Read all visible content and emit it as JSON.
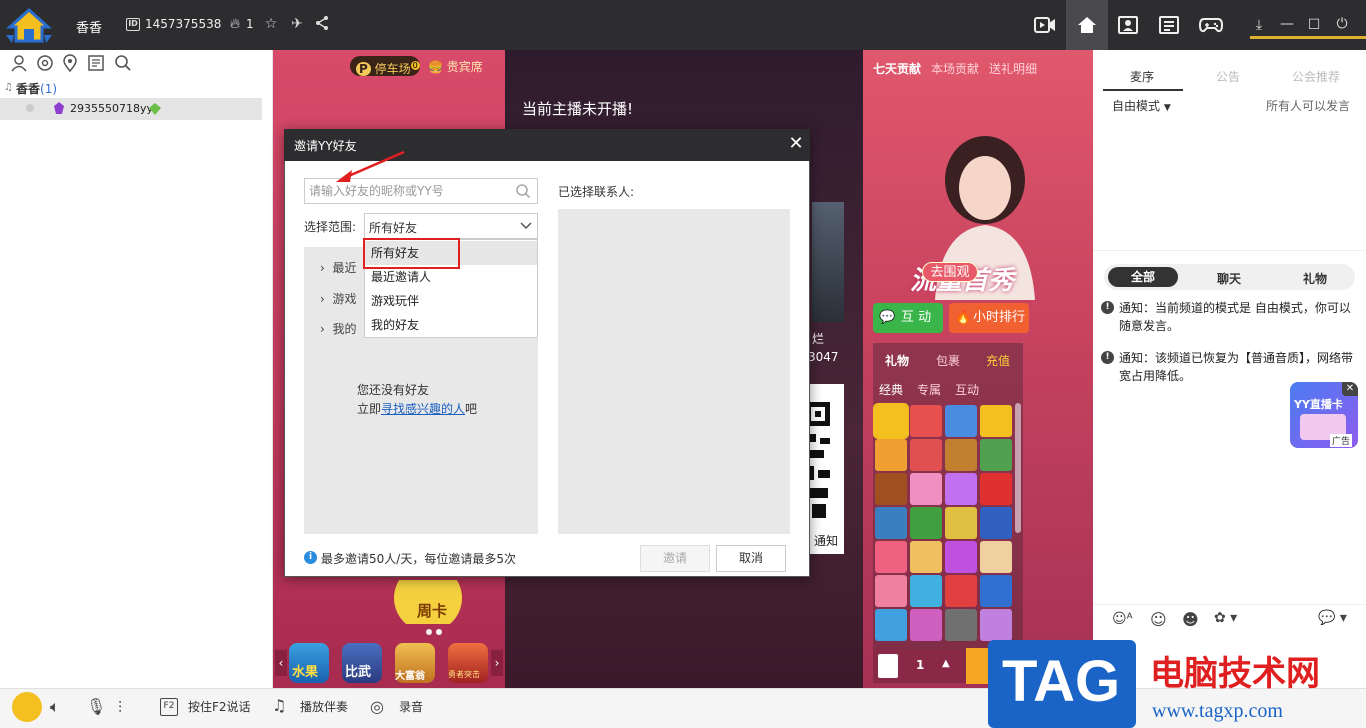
{
  "topbar": {
    "room_name": "香香",
    "room_id": "1457375538",
    "id_badge": "ID",
    "fire_count": "1"
  },
  "left": {
    "tree_root_name": "香香",
    "tree_root_count": "(1)",
    "tree_user": "2935550718yy"
  },
  "stage": {
    "parking": "停车场",
    "parking_count": "0",
    "vip_seat": "贵宾席",
    "not_live": "当前主播未开播!",
    "tabs": [
      "七天贡献",
      "本场贡献",
      "送礼明细"
    ],
    "go_watch": "去围观",
    "host_title": "流量首秀",
    "interact": "互 动",
    "rank": "小时排行",
    "gift_tabs": [
      "礼物",
      "包裹",
      "充值"
    ],
    "gift_sub": [
      "经典",
      "专属",
      "互动"
    ],
    "gift_qty": "1",
    "peek_text1": "烂",
    "peek_text2": "3047",
    "peek_text3": "通知",
    "week_card": "周卡",
    "bottom_games": [
      "水果",
      "比武",
      "大富翁",
      "勇者突击"
    ]
  },
  "right": {
    "tabs": [
      "麦序",
      "公告",
      "公会推荐"
    ],
    "free_mode": "自由模式",
    "all_speak": "所有人可以发言",
    "chat_tabs": [
      "全部",
      "聊天",
      "礼物"
    ],
    "notice1": "通知：当前频道的模式是 自由模式，你可以随意发言。",
    "notice2": "通知：该频道已恢复为【普通音质】，网络带宽占用降低。",
    "ad_title": "YY直播卡",
    "ad_label": "广告"
  },
  "bottom": {
    "f2_key": "F2",
    "f2_label": "按住F2说话",
    "music": "播放伴奏",
    "record": "录音"
  },
  "dialog": {
    "title": "邀请YY好友",
    "close": "✕",
    "search_placeholder": "请输入好友的昵称或YY号",
    "scope_label": "选择范围:",
    "scope_value": "所有好友",
    "dropdown_options": [
      "所有好友",
      "最近邀请人",
      "游戏玩伴",
      "我的好友"
    ],
    "groups_partial": [
      "最近",
      "游戏",
      "我的"
    ],
    "empty_line1": "您还没有好友",
    "empty_line2_prefix": "立即",
    "empty_line2_link": "寻找感兴趣的人",
    "empty_line2_suffix": "吧",
    "selected_label": "已选择联系人:",
    "info": "最多邀请50人/天，每位邀请最多5次",
    "invite_btn": "邀请",
    "cancel_btn": "取消"
  },
  "watermark": {
    "logo": "TAG",
    "cn": "电脑技术网",
    "url": "www.tagxp.com"
  }
}
